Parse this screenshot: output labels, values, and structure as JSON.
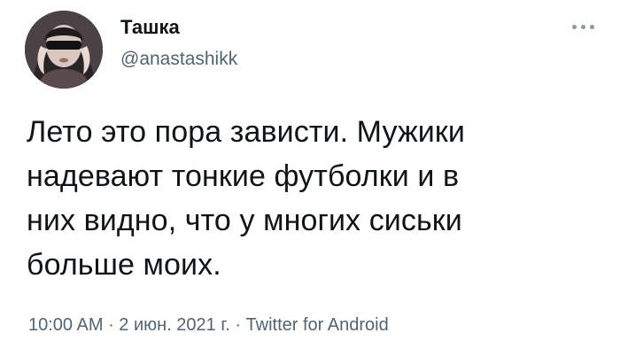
{
  "tweet": {
    "author": {
      "display_name": "Ташка",
      "handle": "@anastashikk",
      "avatar": "avatar-photo"
    },
    "more_icon": "more-horizontal-icon",
    "text": "Лето это пора зависти. Мужики\nнадевают тонкие футболки и в\nних видно, что у многих сиськи\nбольше моих.",
    "time": "10:00 AM",
    "separator_1": " · ",
    "date": "2 июн. 2021 г.",
    "separator_2": " · ",
    "source": "Twitter for Android"
  }
}
